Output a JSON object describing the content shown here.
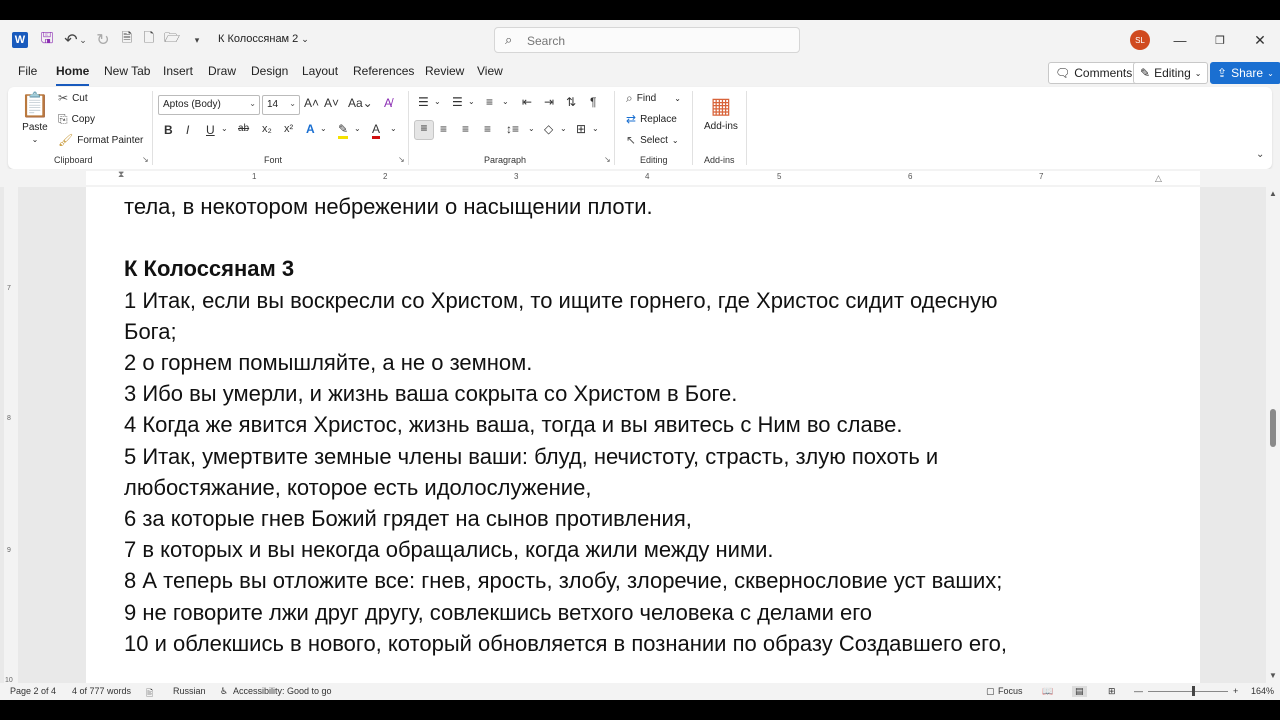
{
  "titlebar": {
    "doc_title": "К Колоссянам 2",
    "search_placeholder": "Search",
    "avatar_initials": "SL"
  },
  "tabs": [
    "File",
    "Home",
    "New Tab",
    "Insert",
    "Draw",
    "Design",
    "Layout",
    "References",
    "Review",
    "View"
  ],
  "active_tab": "Home",
  "right_buttons": {
    "comments": "Comments",
    "editing": "Editing",
    "share": "Share"
  },
  "ribbon": {
    "clipboard": {
      "paste": "Paste",
      "cut": "Cut",
      "copy": "Copy",
      "format_painter": "Format Painter",
      "label": "Clipboard"
    },
    "font": {
      "name": "Aptos (Body)",
      "size": "14",
      "label": "Font"
    },
    "paragraph": {
      "label": "Paragraph"
    },
    "editing": {
      "find": "Find",
      "replace": "Replace",
      "select": "Select",
      "label": "Editing"
    },
    "addins": {
      "button": "Add-ins",
      "label": "Add-ins"
    }
  },
  "ruler": {
    "numbers": [
      "1",
      "2",
      "3",
      "4",
      "5",
      "6",
      "7"
    ]
  },
  "vruler": {
    "numbers": [
      "7",
      "8",
      "9",
      "10"
    ]
  },
  "document": {
    "lines": [
      {
        "text": "тела, в некотором небрежении о насыщении плоти.",
        "bold": false
      },
      {
        "text": "",
        "bold": false
      },
      {
        "text": "К Колоссянам 3",
        "bold": true
      },
      {
        "text": "1 Итак, если вы воскресли со Христом, то ищите горнего, где Христос сидит одесную",
        "bold": false
      },
      {
        "text": "Бога;",
        "bold": false
      },
      {
        "text": "2 о горнем помышляйте, а не о земном.",
        "bold": false
      },
      {
        "text": "3 Ибо вы умерли, и жизнь ваша сокрыта со Христом в Боге.",
        "bold": false
      },
      {
        "text": "4 Когда же явится Христос, жизнь ваша, тогда и вы явитесь с Ним во славе.",
        "bold": false
      },
      {
        "text": "5 Итак, умертвите земные члены ваши: блуд, нечистоту, страсть, злую похоть и",
        "bold": false
      },
      {
        "text": "любостяжание, которое есть идолослужение,",
        "bold": false
      },
      {
        "text": "6 за которые гнев Божий грядет на сынов противления,",
        "bold": false
      },
      {
        "text": "7 в которых и вы некогда обращались, когда жили между ними.",
        "bold": false
      },
      {
        "text": "8 А теперь вы отложите все: гнев, ярость, злобу, злоречие, сквернословие уст ваших;",
        "bold": false
      },
      {
        "text": "9 не говорите лжи друг другу, совлекшись ветхого человека с делами его",
        "bold": false
      },
      {
        "text": "10 и облекшись в нового, который обновляется в познании по образу Создавшего его,",
        "bold": false
      }
    ]
  },
  "statusbar": {
    "page": "Page 2 of 4",
    "words": "4 of 777 words",
    "language": "Russian",
    "accessibility": "Accessibility: Good to go",
    "focus": "Focus",
    "zoom": "164%"
  },
  "colors": {
    "accent": "#185abd",
    "share": "#1a6fd1",
    "avatar": "#d04a1f",
    "save_icon": "#8b2db3"
  }
}
